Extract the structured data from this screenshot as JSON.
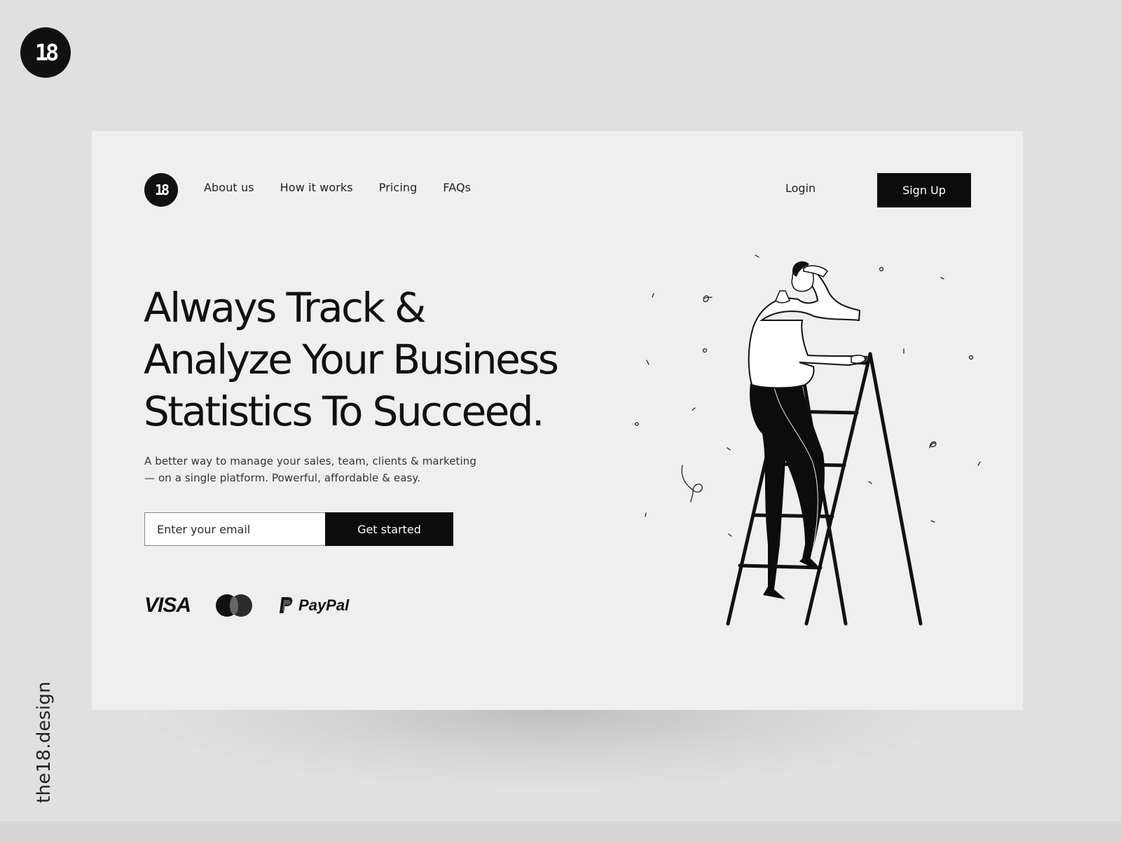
{
  "page": {
    "brand_badge": "18",
    "vertical_caption": "the18.design"
  },
  "nav": {
    "logo": "18",
    "links": [
      "About us",
      "How it works",
      "Pricing",
      "FAQs"
    ],
    "login": "Login",
    "signup": "Sign Up"
  },
  "hero": {
    "title_lines": [
      "Always Track &",
      "Analyze Your Business",
      "Statistics To Succeed."
    ],
    "subtitle_lines": [
      "A better way to manage your sales, team, clients & marketing",
      "— on a single platform. Powerful, affordable & easy."
    ],
    "email_placeholder": "Enter your email",
    "email_value": "",
    "cta": "Get started"
  },
  "payments": {
    "visa": "VISA",
    "mastercard": "mastercard-logo",
    "paypal": "PayPal"
  },
  "illustration": {
    "subject": "man-on-ladder-looking-far",
    "colors": {
      "ink": "#111111",
      "paper": "#ffffff"
    }
  },
  "colors": {
    "page_bg": "#e0e0e0",
    "card_bg": "#efefef",
    "primary": "#0c0c0c",
    "text": "#111111"
  }
}
